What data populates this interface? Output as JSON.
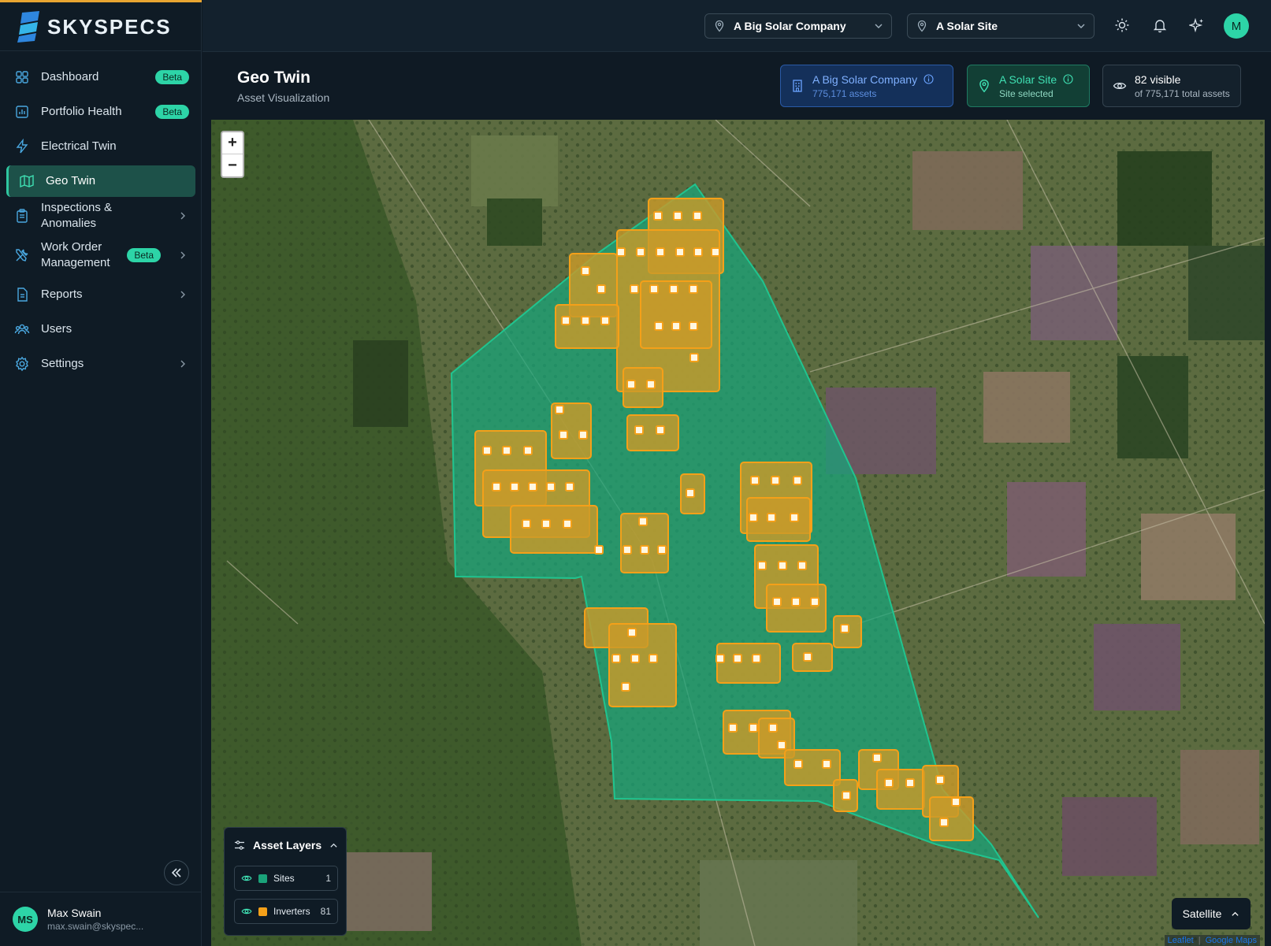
{
  "brand": {
    "name": "SKYSPECS",
    "accent": "#e8a531",
    "primary": "#2dd4a7"
  },
  "sidebar": {
    "items": [
      {
        "label": "Dashboard",
        "icon": "grid-icon",
        "badge": "Beta",
        "chevron": false
      },
      {
        "label": "Portfolio Health",
        "icon": "bar-chart-icon",
        "badge": "Beta",
        "chevron": false
      },
      {
        "label": "Electrical Twin",
        "icon": "lightning-icon",
        "badge": "",
        "chevron": false
      },
      {
        "label": "Geo Twin",
        "icon": "map-icon",
        "badge": "",
        "chevron": false,
        "active": true
      },
      {
        "label": "Inspections & Anomalies",
        "icon": "clipboard-icon",
        "badge": "",
        "chevron": true
      },
      {
        "label": "Work Order\nManagement",
        "icon": "tools-icon",
        "badge": "Beta",
        "chevron": true
      },
      {
        "label": "Reports",
        "icon": "document-icon",
        "badge": "",
        "chevron": true
      },
      {
        "label": "Users",
        "icon": "users-icon",
        "badge": "",
        "chevron": false
      },
      {
        "label": "Settings",
        "icon": "gear-icon",
        "badge": "",
        "chevron": true
      }
    ],
    "user": {
      "initials": "MS",
      "name": "Max Swain",
      "email": "max.swain@skyspec..."
    }
  },
  "topbar": {
    "company_select": "A Big Solar Company",
    "site_select": "A Solar Site",
    "avatar_initial": "M",
    "icons": [
      "sun-icon",
      "bell-icon",
      "sparkle-icon"
    ]
  },
  "header": {
    "title": "Geo Twin",
    "subtitle": "Asset Visualization",
    "company_chip": {
      "title": "A Big Solar Company",
      "sub": "775,171 assets"
    },
    "site_chip": {
      "title": "A Solar Site",
      "sub": "Site selected"
    },
    "visible_chip": {
      "title": "82 visible",
      "sub": "of 775,171 total assets"
    }
  },
  "map": {
    "zoom_in": "+",
    "zoom_out": "−",
    "layers_title": "Asset Layers",
    "layers": [
      {
        "name": "Sites",
        "count": "1",
        "color": "#1aa37a"
      },
      {
        "name": "Inverters",
        "count": "81",
        "color": "#f4a019"
      }
    ],
    "basemap": "Satellite",
    "attribution": {
      "leaflet": "Leaflet",
      "provider": "Google Maps"
    }
  }
}
